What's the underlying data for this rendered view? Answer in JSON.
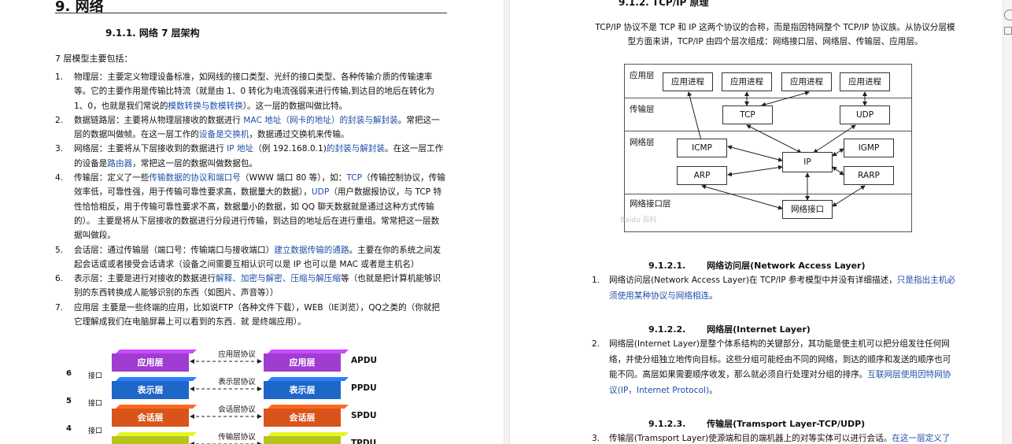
{
  "left": {
    "chapter_title": "9. 网络",
    "section_title": "9.1.1. 网络 7 层架构",
    "intro": "7 层模型主要包括：",
    "items": [
      {
        "num": "1.",
        "parts": [
          {
            "t": "物理层：主要定义物理设备标准，如网线的接口类型、光纤的接口类型、各种传输介质的传输速率等。它的主要作用是传输比特流（就是由 1、0 转化为电流强弱来进行传输,到达目的地后在转化为 1、0，也就是我们常说的"
          },
          {
            "t": "模数转换与数模转换",
            "link": true
          },
          {
            "t": "）。这一层的数据叫做比特。"
          }
        ]
      },
      {
        "num": "2.",
        "parts": [
          {
            "t": "数据链路层：主要将从物理层接收的数据进行 "
          },
          {
            "t": "MAC 地址（网卡的地址）的封装与解封装",
            "link": true
          },
          {
            "t": "。常把这一层的数据叫做帧。在这一层工作的"
          },
          {
            "t": "设备是交换机",
            "link": true
          },
          {
            "t": "，数据通过交换机来传输。"
          }
        ]
      },
      {
        "num": "3.",
        "parts": [
          {
            "t": "网络层：主要将从下层接收到的数据进行 "
          },
          {
            "t": "IP 地址",
            "link": true
          },
          {
            "t": "（例 192.168.0.1)"
          },
          {
            "t": "的封装与解封装",
            "link": true
          },
          {
            "t": "。在这一层工作的设备是"
          },
          {
            "t": "路由器",
            "link": true
          },
          {
            "t": "，常把这一层的数据叫做数据包。"
          }
        ]
      },
      {
        "num": "4.",
        "parts": [
          {
            "t": "传输层：定义了一些"
          },
          {
            "t": "传输数据的协议和端口号",
            "link": true
          },
          {
            "t": "（WWW 端口 80 等），如："
          },
          {
            "t": "TCP",
            "link": true
          },
          {
            "t": "（传输控制协议，传输效率低，可靠性强，用于传输可靠性要求高，数据量大的数据），"
          },
          {
            "t": "UDP",
            "link": true
          },
          {
            "t": "（用户数据报协议，与 TCP 特性恰恰相反，用于传输可靠性要求不高，数据量小的数据，如 QQ 聊天数据就是通过这种方式传输的）。 主要是将从下层接收的数据进行分段进行传输，到达目的地址后在进行重组。常常把这一层数据叫做段。"
          }
        ]
      },
      {
        "num": "5.",
        "parts": [
          {
            "t": "会话层：通过传输层（端口号：传输端口与接收端口）"
          },
          {
            "t": "建立数据传输的通路",
            "link": true
          },
          {
            "t": "。主要在你的系统之间发起会话或或者接受会话请求（设备之间需要互相认识可以是 IP 也可以是 MAC 或者是主机名）"
          }
        ]
      },
      {
        "num": "6.",
        "parts": [
          {
            "t": "表示层：主要是进行对接收的数据进行"
          },
          {
            "t": "解释、加密与解密、压缩与解压缩",
            "link": true
          },
          {
            "t": "等（也就是把计算机能够识别的东西转换成人能够识别的东西（如图片、声音等））"
          }
        ]
      },
      {
        "num": "7.",
        "parts": [
          {
            "t": "应用层 主要是一些终端的应用，比如说FTP（各种文件下载），WEB（IE浏览），QQ之类的（你就把它理解成我们在电脑屏幕上可以看到的东西．就 是终端应用）。"
          }
        ]
      }
    ],
    "osi_diagram": {
      "rows": [
        {
          "num": "6",
          "iface": "接口",
          "layer": "应用层",
          "color": "#a03ccf",
          "proto": "应用层协议",
          "pdu": "APDU"
        },
        {
          "num": "5",
          "iface": "接口",
          "layer": "表示层",
          "color": "#1f66c9",
          "proto": "表示层协议",
          "pdu": "PPDU"
        },
        {
          "num": "4",
          "iface": "接口",
          "layer": "会话层",
          "color": "#d8541a",
          "proto": "会话层协议",
          "pdu": "SPDU"
        },
        {
          "num": "",
          "iface": "",
          "layer": "",
          "color": "#b7c41b",
          "proto": "传输层协议",
          "pdu": "TPDU"
        }
      ]
    }
  },
  "right": {
    "section_title": "9.1.2. TCP/IP 原理",
    "intro": "TCP/IP 协议不是 TCP 和 IP 这两个协议的合称，而是指因特网整个 TCP/IP 协议族。从协议分层模型方面来讲，TCP/IP 由四个层次组成：网络接口层、网络层、传输层、应用层。",
    "tcpip_diagram": {
      "layers": [
        "应用层",
        "传输层",
        "网络层",
        "网络接口层"
      ],
      "app_nodes": [
        "应用进程",
        "应用进程",
        "应用进程",
        "应用进程"
      ],
      "transport_nodes": [
        "TCP",
        "UDP"
      ],
      "network_nodes": [
        "ICMP",
        "IP",
        "IGMP",
        "ARP",
        "RARP"
      ],
      "iface_node": "网络接口",
      "watermark": "Baidu 百科"
    },
    "subsections": [
      {
        "title": "9.1.2.1.       网络访问层(Network Access Layer)",
        "num": "1.",
        "parts": [
          {
            "t": "网络访问层(Network Access Layer)在 TCP/IP 参考模型中并没有详细描述，"
          },
          {
            "t": "只是指出主机必须使用某种协议与网络相连",
            "link": true
          },
          {
            "t": "。"
          }
        ]
      },
      {
        "title": "9.1.2.2.       网络层(Internet Layer)",
        "num": "2.",
        "parts": [
          {
            "t": "网络层(Internet Layer)是整个体系结构的关键部分，其功能是使主机可以把分组发往任何网络，并使分组独立地传向目标。这些分组可能经由不同的网络，到达的顺序和发送的顺序也可能不同。高层如果需要顺序收发，那么就必须自行处理对分组的排序。"
          },
          {
            "t": "互联网层使用因特网协议(IP，Internet Protocol)",
            "link": true
          },
          {
            "t": "。"
          }
        ]
      },
      {
        "title": "9.1.2.3.       传输层(Tramsport Layer-TCP/UDP)",
        "num": "3.",
        "parts": [
          {
            "t": "传输层(Tramsport Layer)使源端和目的端机器上的对等实体可以进行会话。"
          },
          {
            "t": "在这一层定义了",
            "link": true
          }
        ]
      }
    ]
  }
}
